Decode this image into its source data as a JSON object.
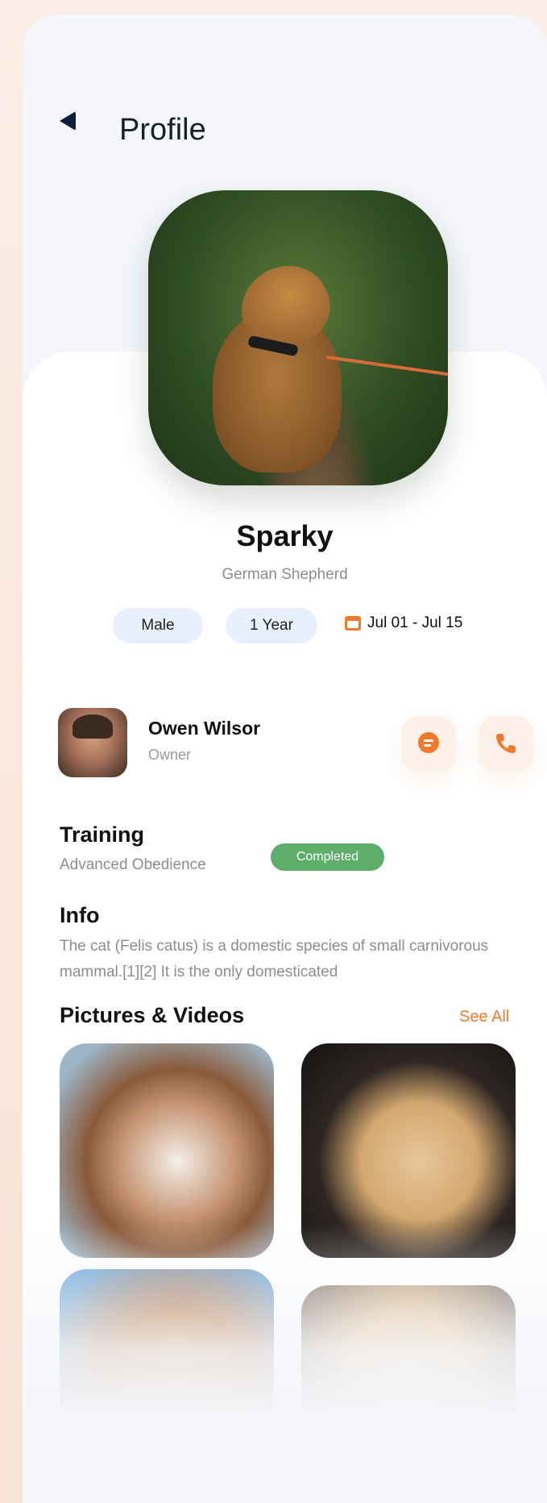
{
  "header": {
    "title": "Profile"
  },
  "pet": {
    "name": "Sparky",
    "breed": "German Shepherd",
    "gender": "Male",
    "age": "1 Year",
    "date_range": "Jul 01 - Jul 15"
  },
  "owner": {
    "name": "Owen Wilsor",
    "role": "Owner"
  },
  "training": {
    "title": "Training",
    "subtitle": "Advanced Obedience",
    "status": "Completed"
  },
  "info": {
    "title": "Info",
    "text": "The cat (Felis catus) is a domestic species of small carnivorous mammal.[1][2] It is the only domesticated"
  },
  "media": {
    "title": "Pictures & Videos",
    "see_all": "See All"
  },
  "colors": {
    "accent": "#f07a2c",
    "badge": "#5dae6a",
    "chip": "#e9f0fd"
  }
}
